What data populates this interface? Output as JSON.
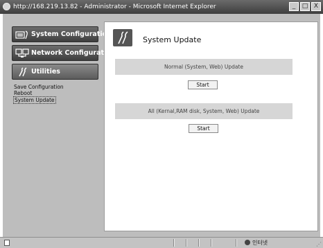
{
  "window": {
    "title": "http://168.219.13.82 - Administrator - Microsoft Internet Explorer",
    "minimize_glyph": "_",
    "maximize_glyph": "□",
    "close_glyph": "X"
  },
  "sidebar": {
    "nav": [
      {
        "label": "System Configuration",
        "icon": "system-config-icon"
      },
      {
        "label": "Network Configuration",
        "icon": "network-config-icon"
      },
      {
        "label": "Utilities",
        "icon": "tools-icon"
      }
    ],
    "links": [
      "Save Configuration",
      "Reboot",
      "System Update"
    ],
    "selected_link": "System Update"
  },
  "main": {
    "title": "System Update",
    "title_icon": "tools-icon",
    "options": [
      {
        "label": "Normal (System, Web) Update",
        "button": "Start"
      },
      {
        "label": "All (Kernal,RAM disk, System, Web) Update",
        "button": "Start"
      }
    ]
  },
  "statusbar": {
    "zone": "인터넷"
  },
  "colors": {
    "nav_button": "#4f4f4f",
    "frame_bg": "#bdbdbd",
    "option_bg": "#d6d6d6",
    "titlebar": "#4a4a4a"
  }
}
